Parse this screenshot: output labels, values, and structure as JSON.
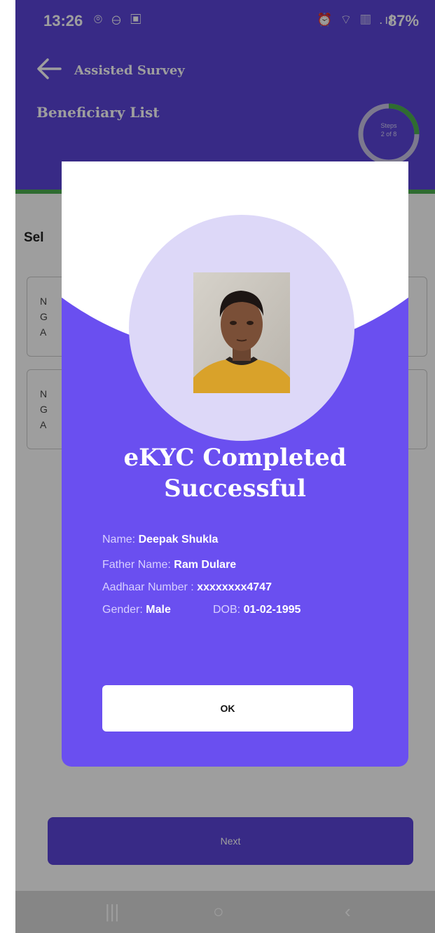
{
  "status_bar": {
    "time": "13:26",
    "left_icons": "⌾ ⊖ ▣",
    "right_icons": "⏰ ⌔ ▥ .ıl",
    "battery": "87%"
  },
  "header": {
    "nav_title": "Assisted Survey",
    "page_title": "Beneficiary List",
    "steps_label": "Steps",
    "steps_value": "2 of 8",
    "step_progress": 0.25
  },
  "background": {
    "select_label": "Sel",
    "cards": [
      {
        "lines": [
          "N",
          "G",
          "A"
        ]
      },
      {
        "lines": [
          "N",
          "G",
          "A"
        ]
      }
    ],
    "next_button": "Next"
  },
  "modal": {
    "title_line1": "eKYC Completed",
    "title_line2": "Successful",
    "name_label": "Name:",
    "name_value": "Deepak Shukla",
    "father_label": "Father Name:",
    "father_value": "Ram Dulare",
    "aadhaar_label": "Aadhaar Number :",
    "aadhaar_value": "xxxxxxxx4747",
    "gender_label": "Gender:",
    "gender_value": "Male",
    "dob_label": "DOB:",
    "dob_value": "01-02-1995",
    "ok_button": "OK"
  },
  "navbar": {
    "recent_icon": "|||",
    "home_icon": "○",
    "back_icon": "‹"
  },
  "colors": {
    "primary": "#5b45d9",
    "modal": "#6a4ff0",
    "progress": "#4caf50"
  }
}
